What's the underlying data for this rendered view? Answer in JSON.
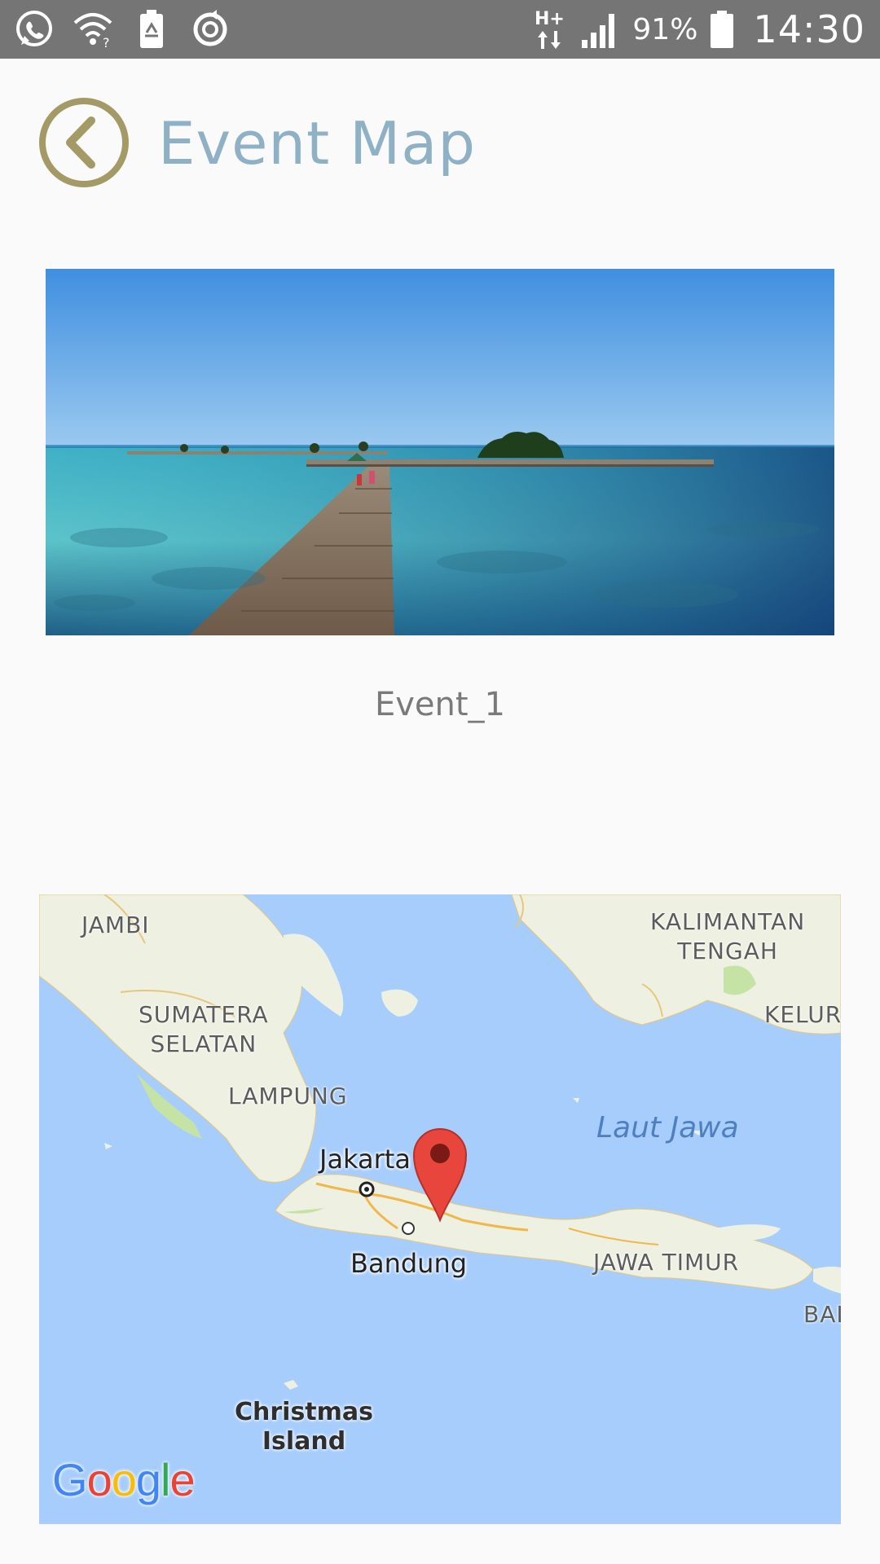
{
  "status_bar": {
    "battery_percent": "91%",
    "network_type": "H+",
    "time": "14:30",
    "icons": [
      "whatsapp-icon",
      "wifi-icon",
      "battery-saver-icon",
      "sync-icon",
      "network-type-icon",
      "signal-icon",
      "battery-icon"
    ]
  },
  "header": {
    "title": "Event Map",
    "back_icon": "back-chevron-icon"
  },
  "event": {
    "name": "Event_1",
    "image": "beach-pier-photo"
  },
  "map": {
    "labels": {
      "jambi": "JAMBI",
      "sumatera_selatan_1": "SUMATERA",
      "sumatera_selatan_2": "SELATAN",
      "lampung": "LAMPUNG",
      "kalimantan_1": "KALIMANTAN",
      "kalimantan_2": "TENGAH",
      "kelura": "KELURA",
      "jawa_timur": "JAWA TIMUR",
      "bali": "BAL",
      "laut_jawa": "Laut Jawa",
      "jakarta": "Jakarta",
      "bandung": "Bandung",
      "christmas_1": "Christmas",
      "christmas_2": "Island"
    },
    "attribution": "Google",
    "colors": {
      "water": "#a6cdfb",
      "land": "#eef0e2",
      "park": "#c6e3a6",
      "pin": "#e8453c"
    }
  },
  "colors": {
    "status_bar": "#757575",
    "background": "#fafafa",
    "title": "#8fb1c6",
    "back_button": "#a39a66"
  }
}
